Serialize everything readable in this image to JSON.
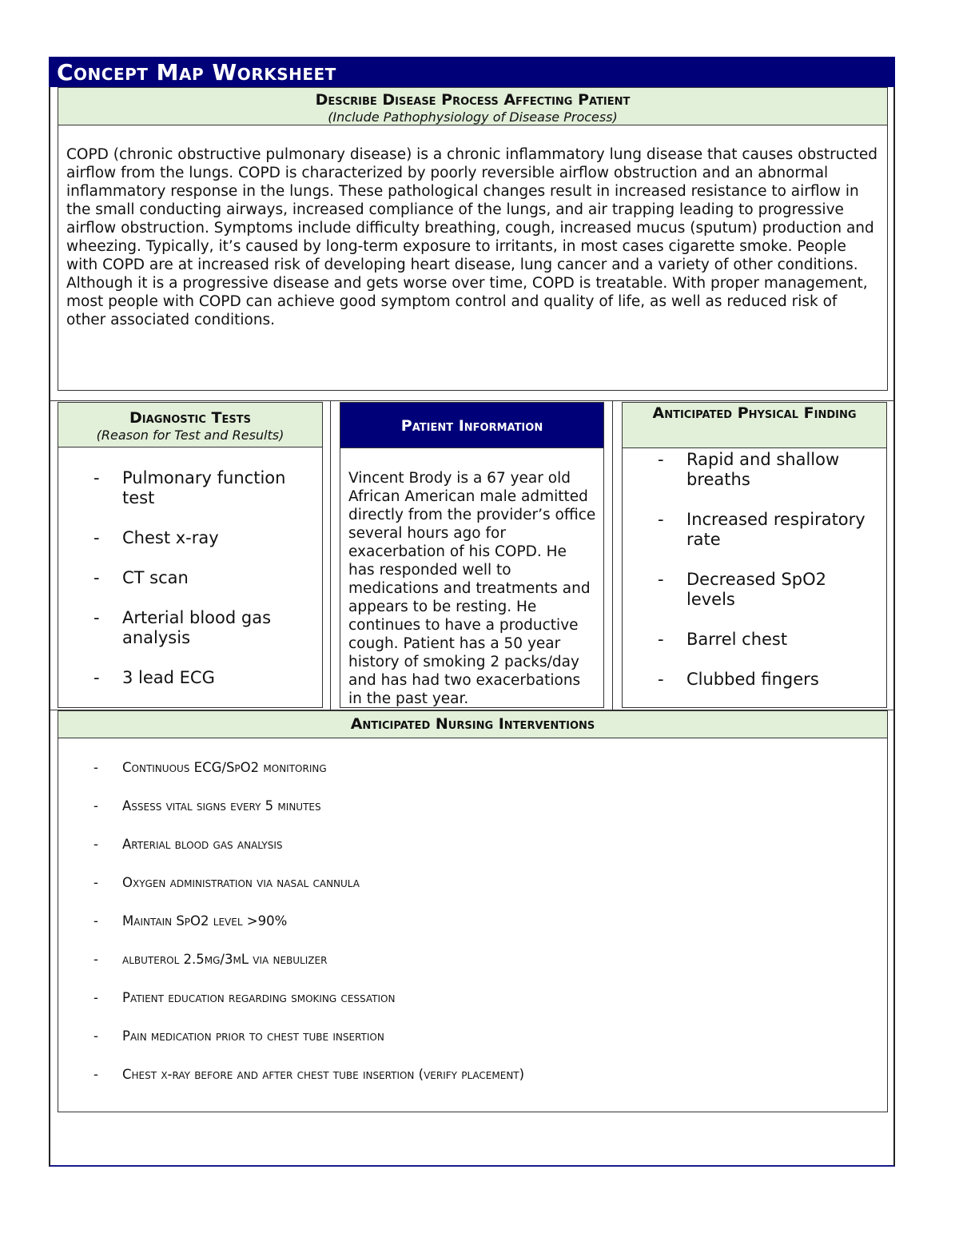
{
  "title": "Concept Map Worksheet",
  "colors": {
    "navy": "#000078",
    "green_header": "#e2efd9",
    "border": "#333333"
  },
  "disease_process": {
    "heading": "Describe Disease Process Affecting Patient",
    "subheading": "(Include Pathophysiology of Disease Process)",
    "text": "COPD (chronic obstructive pulmonary disease) is a chronic inflammatory lung disease that causes obstructed airflow from the lungs. COPD is characterized by poorly reversible airflow obstruction and an abnormal inflammatory response in the lungs. These pathological changes result in increased resistance to airflow in the small conducting airways, increased compliance of the lungs, and air trapping leading to progressive airflow obstruction. Symptoms include difficulty breathing, cough, increased mucus (sputum) production and wheezing. Typically, it’s caused by long-term exposure to irritants, in most cases cigarette smoke. People with COPD are at increased risk of developing heart disease, lung cancer and a variety of other conditions. Although it is a progressive disease and gets worse over time, COPD is treatable. With proper management, most people with COPD can achieve good symptom control and quality of life, as well as reduced risk of other associated conditions."
  },
  "diagnostic_tests": {
    "heading": "Diagnostic Tests",
    "subheading": "(Reason for Test and Results)",
    "items": [
      "Pulmonary function test",
      "Chest x-ray",
      "CT scan",
      "Arterial blood gas analysis",
      "3 lead ECG"
    ]
  },
  "patient_information": {
    "heading": "Patient Information",
    "text": "Vincent Brody is a 67 year old African American male admitted directly from the provider’s office several hours ago for exacerbation of his COPD. He has responded well to medications and treatments and appears to be resting. He continues to have a productive cough. Patient has a 50 year history of smoking 2 packs/day and has had two exacerbations in the past year."
  },
  "physical_findings": {
    "heading": "Anticipated Physical Finding",
    "items": [
      "Rapid and shallow breaths",
      "Increased respiratory rate",
      "Decreased SpO2 levels",
      "Barrel chest",
      "Clubbed fingers"
    ]
  },
  "nursing_interventions": {
    "heading": "Anticipated Nursing Interventions",
    "items": [
      "Continuous ECG/SpO2 monitoring",
      "Assess vital signs every 5 minutes",
      "Arterial blood gas analysis",
      "Oxygen administration via nasal cannula",
      "Maintain SpO2 level >90%",
      "albuterol 2.5mg/3mL via nebulizer",
      "Patient education regarding smoking cessation",
      "Pain medication prior to chest tube insertion",
      "Chest x-ray before and after chest tube insertion (verify placement)"
    ]
  },
  "bullet_marker": "-"
}
